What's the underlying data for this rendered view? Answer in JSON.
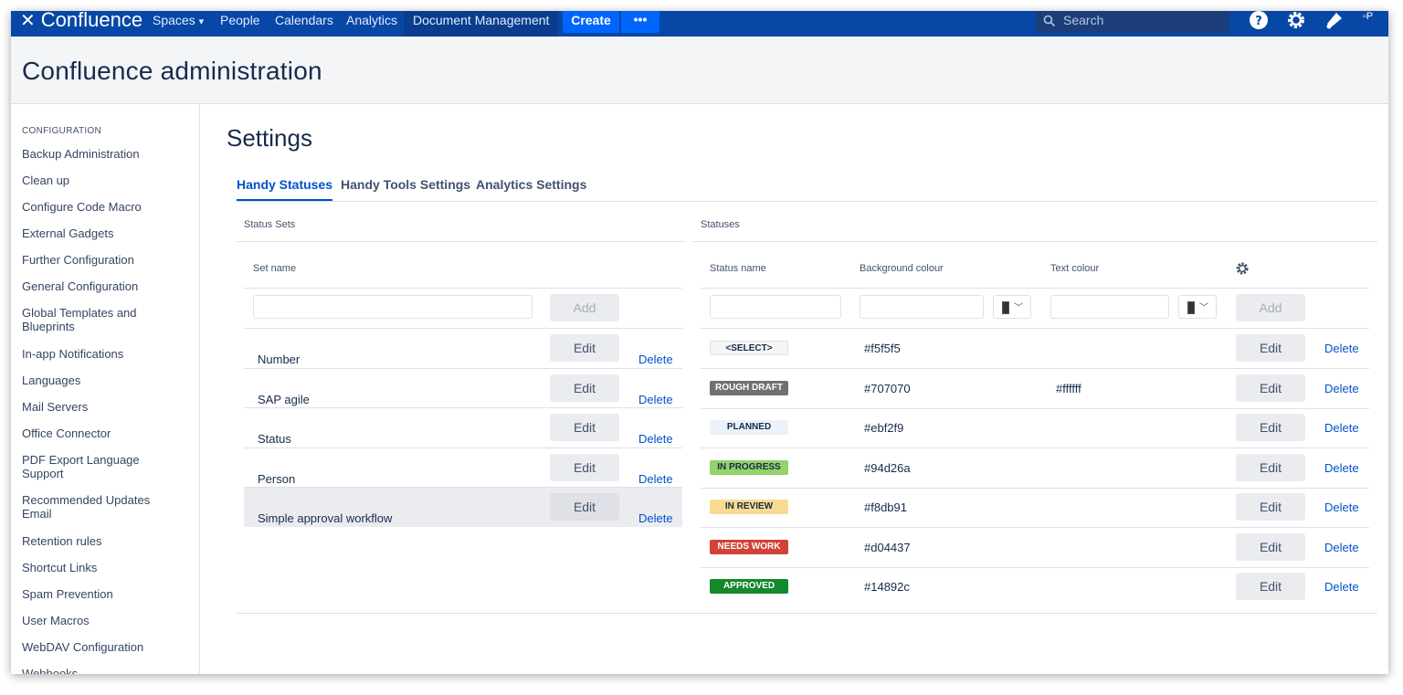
{
  "topnav": {
    "logo": "Confluence",
    "links": [
      "Spaces",
      "People",
      "Calendars",
      "Analytics",
      "Document Management"
    ],
    "spaces_chevron": "▾",
    "create_label": "Create",
    "more_label": "•••",
    "search_placeholder": "Search",
    "icons": [
      "help-icon",
      "settings-icon",
      "notifications-icon",
      "avatar"
    ]
  },
  "admin": {
    "title": "Confluence administration"
  },
  "sidebar": {
    "heading": "CONFIGURATION",
    "items": [
      "Backup Administration",
      "Clean up",
      "Configure Code Macro",
      "External Gadgets",
      "Further Configuration",
      "General Configuration",
      "Global Templates and Blueprints",
      "In-app Notifications",
      "Languages",
      "Mail Servers",
      "Office Connector",
      "PDF Export Language Support",
      "Recommended Updates Email",
      "Retention rules",
      "Shortcut Links",
      "Spam Prevention",
      "User Macros",
      "WebDAV Configuration",
      "Webhooks"
    ]
  },
  "main": {
    "title": "Settings",
    "tabs": [
      "Handy Statuses",
      "Handy Tools Settings",
      "Analytics Settings"
    ],
    "status_sets": {
      "section_label": "Status Sets",
      "column_header": "Set name",
      "add_label": "Add",
      "edit_label": "Edit",
      "delete_label": "Delete",
      "rows": [
        "Number",
        "SAP agile",
        "Status",
        "Person",
        "Simple approval workflow"
      ]
    },
    "statuses": {
      "section_label": "Statuses",
      "col_status_name": "Status name",
      "col_background": "Background colour",
      "col_text": "Text colour",
      "add_label": "Add",
      "edit_label": "Edit",
      "delete_label": "Delete",
      "rows": [
        {
          "name": "<SELECT>",
          "background": "#f5f5f5",
          "text_colour": "",
          "fg": "#172b4d"
        },
        {
          "name": "ROUGH DRAFT",
          "background": "#707070",
          "text_colour": "#ffffff",
          "fg": "#ffffff"
        },
        {
          "name": "PLANNED",
          "background": "#ebf2f9",
          "text_colour": "",
          "fg": "#172b4d"
        },
        {
          "name": "IN PROGRESS",
          "background": "#94d26a",
          "text_colour": "",
          "fg": "#172b4d"
        },
        {
          "name": "IN REVIEW",
          "background": "#f8db91",
          "text_colour": "",
          "fg": "#172b4d"
        },
        {
          "name": "NEEDS WORK",
          "background": "#d04437",
          "text_colour": "",
          "fg": "#ffffff"
        },
        {
          "name": "APPROVED",
          "background": "#14892c",
          "text_colour": "",
          "fg": "#ffffff"
        }
      ]
    }
  },
  "colors": {
    "nav_bg": "#0747a6",
    "accent": "#0052cc",
    "create_button": "#0065ff"
  }
}
